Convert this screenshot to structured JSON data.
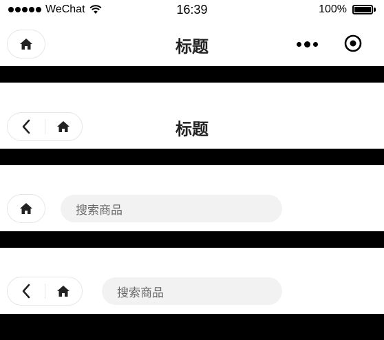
{
  "status_bar": {
    "carrier": "WeChat",
    "time": "16:39",
    "battery": "100%"
  },
  "nav1": {
    "title": "标题",
    "home_icon": "home-icon",
    "menu_icon": "more-dots-icon",
    "close_icon": "target-close-icon"
  },
  "nav2": {
    "title": "标题",
    "back_icon": "chevron-left-icon",
    "home_icon": "home-icon"
  },
  "nav3": {
    "search_placeholder": "搜索商品",
    "home_icon": "home-icon"
  },
  "nav4": {
    "search_placeholder": "搜索商品",
    "back_icon": "chevron-left-icon",
    "home_icon": "home-icon"
  },
  "colors": {
    "background": "#ffffff",
    "separator": "#000000",
    "search_bg": "#f2f2f2",
    "capsule_border": "#e6e6e6",
    "title": "#222222"
  }
}
